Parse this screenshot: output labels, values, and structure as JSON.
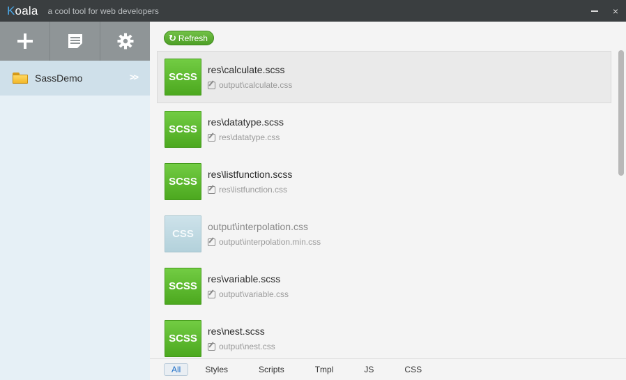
{
  "titlebar": {
    "app_name_first": "K",
    "app_name_rest": "oala",
    "tagline": "a cool tool for web developers",
    "minimize_icon": "minimize-icon",
    "close_icon": "close-icon",
    "close_glyph": "×"
  },
  "sidebar": {
    "toolbar": [
      {
        "icon": "plus-icon"
      },
      {
        "icon": "document-icon"
      },
      {
        "icon": "gear-icon"
      }
    ],
    "project": {
      "name": "SassDemo",
      "icon": "folder-icon",
      "chevron": ">>"
    }
  },
  "main": {
    "refresh_label": "Refresh",
    "files": [
      {
        "type": "SCSS",
        "name": "res\\calculate.scss",
        "output": "output\\calculate.css",
        "selected": true
      },
      {
        "type": "SCSS",
        "name": "res\\datatype.scss",
        "output": "res\\datatype.css"
      },
      {
        "type": "SCSS",
        "name": "res\\listfunction.scss",
        "output": "res\\listfunction.css"
      },
      {
        "type": "CSS",
        "name": "output\\interpolation.css",
        "output": "output\\interpolation.min.css"
      },
      {
        "type": "SCSS",
        "name": "res\\variable.scss",
        "output": "output\\variable.css"
      },
      {
        "type": "SCSS",
        "name": "res\\nest.scss",
        "output": "output\\nest.css"
      }
    ]
  },
  "filters": {
    "tabs": [
      "All",
      "Styles",
      "Scripts",
      "Tmpl",
      "JS",
      "CSS"
    ],
    "active": "All"
  },
  "colors": {
    "scss_badge": "#5cb630",
    "css_badge": "#c2dbe4",
    "titlebar": "#3a3e40",
    "sidebar_toolbar": "#8f9597",
    "accent": "#1f6fc7"
  }
}
